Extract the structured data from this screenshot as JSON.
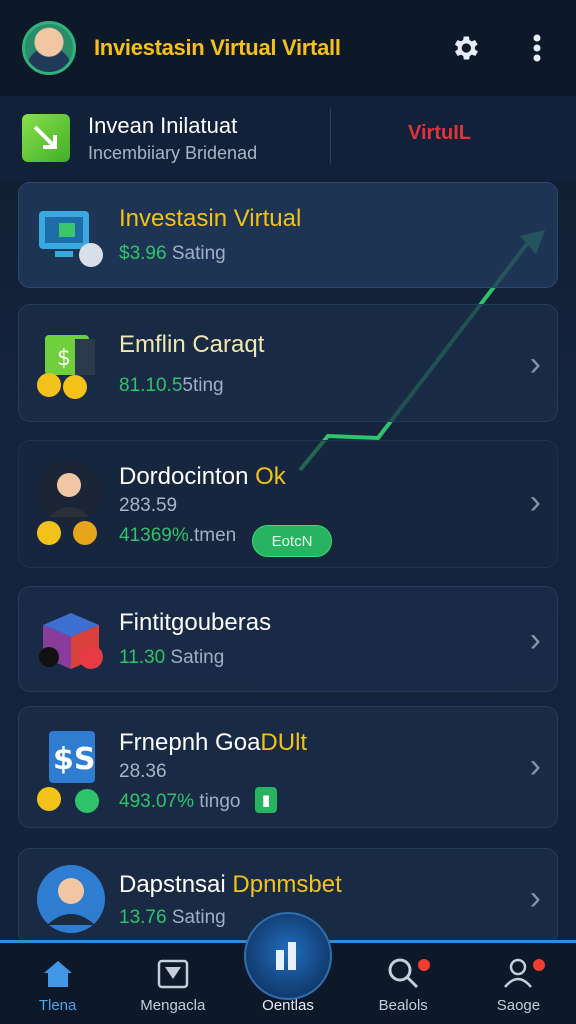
{
  "header": {
    "title": "Inviestasin Virtual Virtall",
    "settings_icon": "gear-icon",
    "menu_icon": "more-vertical-icon"
  },
  "banner": {
    "title": "Invean Inilatuat",
    "subtitle": "Incembiiary Bridenad",
    "tag": "VirtuIL"
  },
  "cards": [
    {
      "title": "Investasin Virtual",
      "sub_value": "$3.96",
      "sub_label": "Sating"
    },
    {
      "title": "Emflin Caraqt",
      "sub_value": "81.10.5",
      "sub_label": "5ting"
    },
    {
      "title_a": "Dordocinton",
      "title_b": "Ok",
      "line2": "283.59",
      "sub_value": "41369%",
      "sub_label": ".tmen",
      "pill": "EotcN"
    },
    {
      "title": "Fintitgouberas",
      "sub_value": "11.30",
      "sub_label": "Sating"
    },
    {
      "title_a": "Frnepnh Goa",
      "title_b": "DUlt",
      "line2": "28.36",
      "sub_value": "493.07%",
      "sub_label": "tingo"
    },
    {
      "title_a": "Dapstnsai",
      "title_b": "Dpnmsbet",
      "sub_value": "13.76",
      "sub_label": "Sating"
    }
  ],
  "bottom_nav": [
    {
      "label": "Tlena",
      "icon": "home-icon",
      "active": true
    },
    {
      "label": "Mengacla",
      "icon": "download-box-icon",
      "active": false
    },
    {
      "label": "Oentlas",
      "icon": "portfolio-icon",
      "active": false
    },
    {
      "label": "Bealols",
      "icon": "search-icon",
      "active": false
    },
    {
      "label": "Saoge",
      "icon": "profile-icon",
      "active": false
    }
  ],
  "colors": {
    "accent_yellow": "#f3c21a",
    "accent_green": "#2ec46a",
    "accent_red": "#e3333a",
    "accent_blue": "#2f8cd8"
  }
}
